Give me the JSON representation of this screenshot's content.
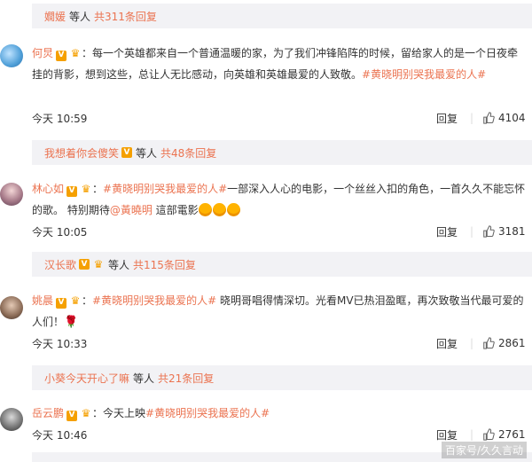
{
  "band0": {
    "name": "嫺媛",
    "text": "等人",
    "count": "共311条回复"
  },
  "comments": [
    {
      "name": "何炅",
      "text_a": "：每一个英雄都来自一个普通温暖的家，为了我们冲锋陷阵的时候，留给家人的是一个日夜牵挂的背影，想到这些，总让人无比感动，向英雄和英雄最爱的人致敬。",
      "tag": "#黄晓明别哭我最爱的人#",
      "time": "今天 10:59",
      "reply": "回复",
      "likes": "4104"
    },
    {
      "name": "林心如",
      "text_a": "：",
      "tag": "#黄晓明别哭我最爱的人#",
      "text_b": "一部深入人心的电影，一个丝丝入扣的角色，一首久久不能忘怀的歌。 特别期待",
      "mention": "@黃曉明",
      "text_c": " 這部電影",
      "time": "今天 10:05",
      "reply": "回复",
      "likes": "3181"
    },
    {
      "name": "姚晨",
      "text_a": "：",
      "tag": "#黄晓明别哭我最爱的人#",
      "text_b": " 晓明哥唱得情深切。光看MV已热泪盈眶，再次致敬当代最可爱的人们！",
      "time": "今天 10:33",
      "reply": "回复",
      "likes": "2861"
    },
    {
      "name": "岳云鹏",
      "text_a": "：今天上映",
      "tag": "#黄晓明别哭我最爱的人#",
      "time": "今天 10:46",
      "reply": "回复",
      "likes": "2761"
    }
  ],
  "band1": {
    "name": "我想着你会傻笑",
    "text": "等人",
    "count": "共48条回复"
  },
  "band2": {
    "name": "汉长歌",
    "text": "等人",
    "count": "共115条回复"
  },
  "band3": {
    "name": "小葵今天开心了嘛",
    "text": "等人",
    "count": "共21条回复"
  },
  "watermark": "百家号/久久言动",
  "colors": {
    "accent": "#eb7350",
    "band": "#f2f2f5",
    "badge": "#f5a000"
  },
  "icons": [
    "verified-v-icon",
    "fan-badge-icon",
    "like-thumb-icon",
    "emoji-icon",
    "rose-icon"
  ]
}
